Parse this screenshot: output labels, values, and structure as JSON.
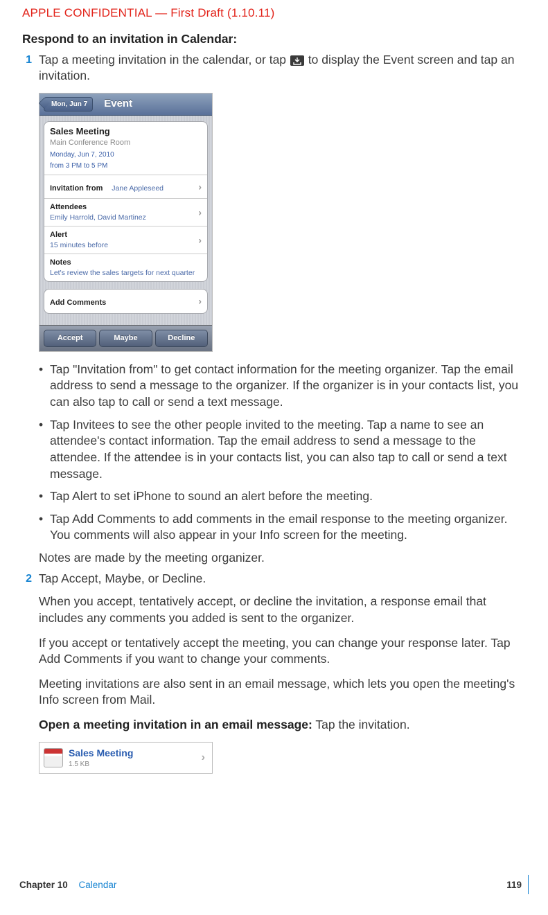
{
  "header": {
    "confidential": "APPLE CONFIDENTIAL — First Draft (1.10.11)"
  },
  "section_title": "Respond to an invitation in Calendar:",
  "step1": {
    "num": "1",
    "text_before": "Tap a meeting invitation in the calendar, or tap ",
    "text_after": " to display the Event screen and tap an invitation."
  },
  "screenshot1": {
    "back": "Mon, Jun 7",
    "title": "Event",
    "meeting_title": "Sales Meeting",
    "meeting_location": "Main Conference Room",
    "meeting_date": "Monday, Jun 7, 2010",
    "meeting_time": "from 3 PM to 5 PM",
    "invitation_from_label": "Invitation from",
    "invitation_from_value": "Jane Appleseed",
    "attendees_label": "Attendees",
    "attendees_value": "Emily Harrold, David Martinez",
    "alert_label": "Alert",
    "alert_value": "15 minutes before",
    "notes_label": "Notes",
    "notes_value": "Let's review the sales targets for next quarter",
    "add_comments": "Add Comments",
    "btn_accept": "Accept",
    "btn_maybe": "Maybe",
    "btn_decline": "Decline"
  },
  "bullets": [
    "Tap \"Invitation from\" to get contact information for the meeting organizer. Tap the email address to send a message to the organizer. If the organizer is in your contacts list, you can also tap to call or send a text message.",
    "Tap Invitees to see the other people invited to the meeting. Tap a name to see an attendee's contact information. Tap the email address to send a message to the attendee. If the attendee is in your contacts list, you can also tap to call or send a text message.",
    "Tap Alert to set iPhone to sound an alert before the meeting.",
    "Tap Add Comments to add comments in the email response to the meeting organizer. You comments will also appear in your Info screen for the meeting."
  ],
  "notes_para": "Notes are made by the meeting organizer.",
  "step2": {
    "num": "2",
    "text": "Tap Accept, Maybe, or Decline."
  },
  "para_a": "When you accept, tentatively accept, or decline the invitation, a response email that includes any comments you added is sent to the organizer.",
  "para_b": "If you accept or tentatively accept the meeting, you can change your response later. Tap Add Comments if you want to change your comments.",
  "para_c": "Meeting invitations are also sent in an email message, which lets you open the meeting's Info screen from Mail.",
  "inline_heading": {
    "bold": "Open a meeting invitation in an email message:",
    "rest": "  Tap the invitation."
  },
  "screenshot2": {
    "title": "Sales Meeting",
    "size": "1.5 KB"
  },
  "footer": {
    "chapter_label": "Chapter 10",
    "chapter_name": "Calendar",
    "page": "119"
  }
}
